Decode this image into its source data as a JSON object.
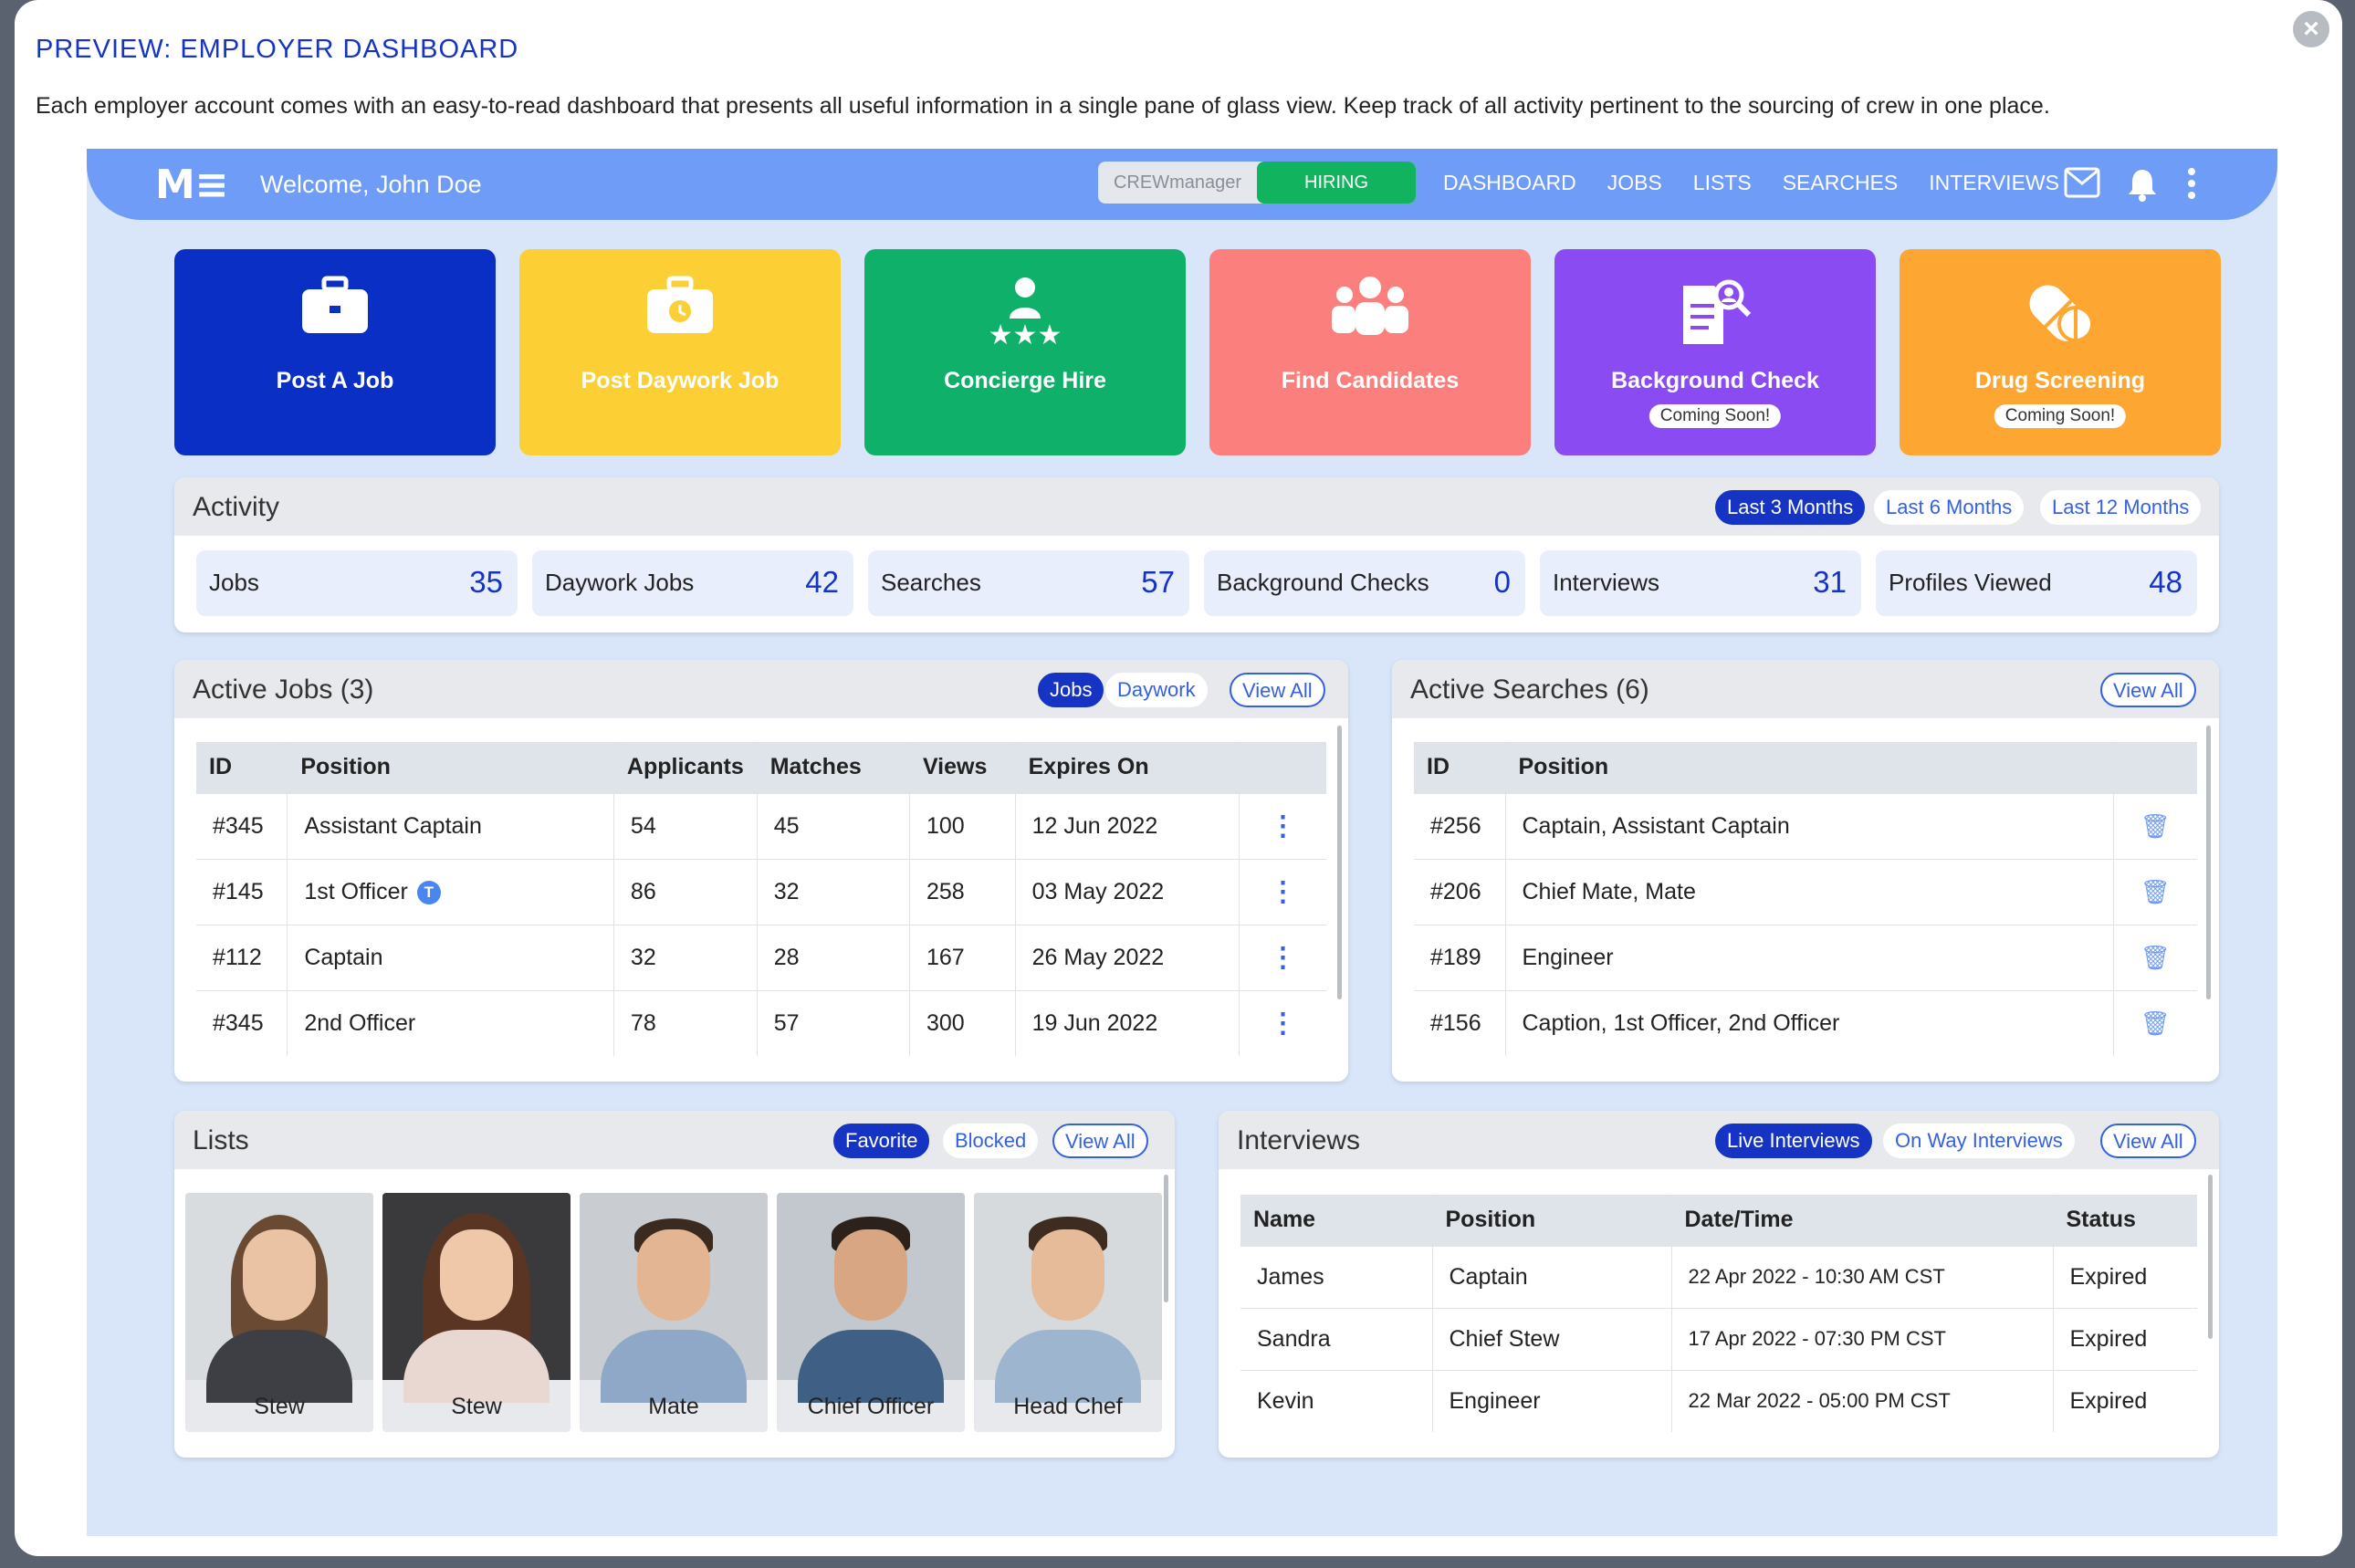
{
  "modal": {
    "title": "PREVIEW: EMPLOYER DASHBOARD",
    "description": "Each employer account comes with an easy-to-read dashboard that presents all useful information in a single pane of glass view. Keep track of all activity pertinent to the sourcing of crew in one place.",
    "close_icon": "close-icon"
  },
  "topbar": {
    "logo": "M≡",
    "welcome": "Welcome,  John Doe",
    "toggle": {
      "left": "CREWmanager",
      "right": "HIRING"
    },
    "nav": [
      "DASHBOARD",
      "JOBS",
      "LISTS",
      "SEARCHES",
      "INTERVIEWS"
    ],
    "icons": [
      "mail-icon",
      "bell-icon",
      "more-vertical-icon"
    ]
  },
  "tiles": [
    {
      "label": "Post A Job",
      "color": "#0a2fc4",
      "icon": "briefcase-icon"
    },
    {
      "label": "Post Daywork Job",
      "color": "#fccf35",
      "icon": "briefcase-clock-icon"
    },
    {
      "label": "Concierge Hire",
      "color": "#0fb06a",
      "icon": "person-stars-icon"
    },
    {
      "label": "Find Candidates",
      "color": "#fb7f7d",
      "icon": "group-icon"
    },
    {
      "label": "Background Check",
      "color": "#8a4cf2",
      "icon": "document-search-icon",
      "badge": "Coming Soon!"
    },
    {
      "label": "Drug Screening",
      "color": "#fda631",
      "icon": "pills-icon",
      "badge": "Coming Soon!"
    }
  ],
  "activity": {
    "title": "Activity",
    "ranges": [
      "Last 3 Months",
      "Last 6 Months",
      "Last 12 Months"
    ],
    "stats": [
      {
        "label": "Jobs",
        "value": "35"
      },
      {
        "label": "Daywork Jobs",
        "value": "42"
      },
      {
        "label": "Searches",
        "value": "57"
      },
      {
        "label": "Background Checks",
        "value": "0"
      },
      {
        "label": "Interviews",
        "value": "31"
      },
      {
        "label": "Profiles Viewed",
        "value": "48"
      }
    ]
  },
  "active_jobs": {
    "title": "Active Jobs (3)",
    "tabs": [
      "Jobs",
      "Daywork"
    ],
    "view_all": "View All",
    "columns": [
      "ID",
      "Position",
      "Applicants",
      "Matches",
      "Views",
      "Expires On",
      ""
    ],
    "rows": [
      {
        "id": "#345",
        "position": "Assistant Captain",
        "applicants": "54",
        "matches": "45",
        "views": "100",
        "expires": "12 Jun 2022"
      },
      {
        "id": "#145",
        "position": "1st Officer",
        "badge": "T",
        "applicants": "86",
        "matches": "32",
        "views": "258",
        "expires": "03 May 2022"
      },
      {
        "id": "#112",
        "position": "Captain",
        "applicants": "32",
        "matches": "28",
        "views": "167",
        "expires": "26 May 2022"
      },
      {
        "id": "#345",
        "position": "2nd Officer",
        "applicants": "78",
        "matches": "57",
        "views": "300",
        "expires": "19 Jun 2022"
      }
    ]
  },
  "active_searches": {
    "title": "Active Searches (6)",
    "view_all": "View All",
    "columns": [
      "ID",
      "Position",
      ""
    ],
    "rows": [
      {
        "id": "#256",
        "position": "Captain, Assistant Captain"
      },
      {
        "id": "#206",
        "position": "Chief Mate, Mate"
      },
      {
        "id": "#189",
        "position": "Engineer"
      },
      {
        "id": "#156",
        "position": "Caption, 1st Officer, 2nd Officer"
      }
    ]
  },
  "lists": {
    "title": "Lists",
    "tabs": [
      "Favorite",
      "Blocked"
    ],
    "view_all": "View All",
    "people": [
      {
        "name": "Stew"
      },
      {
        "name": "Stew"
      },
      {
        "name": "Mate"
      },
      {
        "name": "Chief Officer"
      },
      {
        "name": "Head Chef"
      }
    ]
  },
  "interviews": {
    "title": "Interviews",
    "tabs": [
      "Live Interviews",
      "On Way Interviews"
    ],
    "view_all": "View All",
    "columns": [
      "Name",
      "Position",
      "Date/Time",
      "Status"
    ],
    "rows": [
      {
        "name": "James",
        "position": "Captain",
        "datetime": "22 Apr 2022 - 10:30 AM CST",
        "status": "Expired"
      },
      {
        "name": "Sandra",
        "position": "Chief Stew",
        "datetime": "17 Apr 2022 - 07:30 PM CST",
        "status": "Expired"
      },
      {
        "name": "Kevin",
        "position": "Engineer",
        "datetime": "22 Mar 2022 - 05:00 PM CST",
        "status": "Expired"
      }
    ]
  }
}
